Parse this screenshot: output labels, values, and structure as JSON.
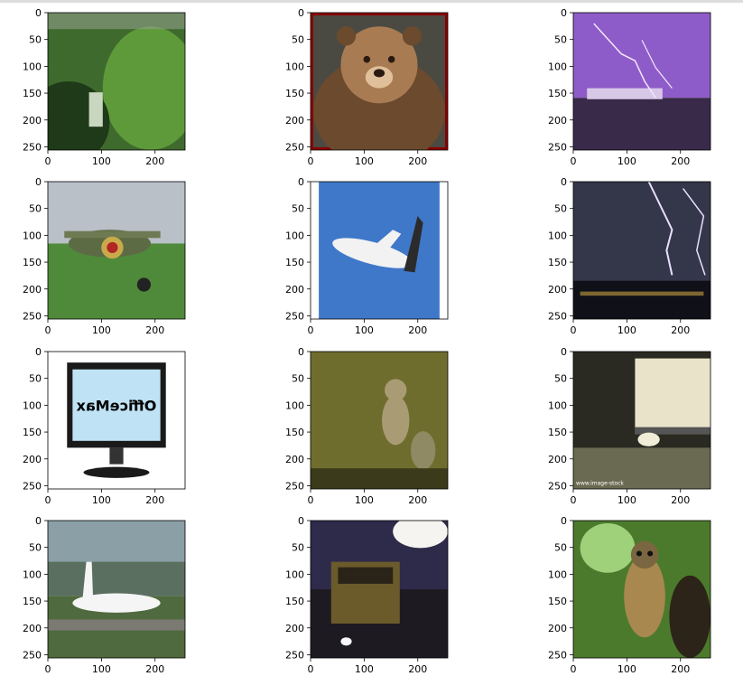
{
  "figure": {
    "rows": 4,
    "cols": 3,
    "panels": [
      {
        "subject": "waterfall-in-forest",
        "colors": {
          "bg": "#3f6a2e",
          "accent": "#c9d7c0",
          "dark": "#1f3a18"
        }
      },
      {
        "subject": "brown-bear-portrait",
        "colors": {
          "bg": "#6b4a2e",
          "accent": "#a87b52",
          "dark": "#2a1a10",
          "border": "#8b0000"
        }
      },
      {
        "subject": "purple-lightning-over-city",
        "colors": {
          "bg": "#8e5cc8",
          "accent": "#f4e6ff",
          "dark": "#3a2a4a"
        }
      },
      {
        "subject": "vintage-propeller-airplane",
        "colors": {
          "bg": "#b9c0c8",
          "accent": "#5d6b45",
          "dark": "#4f8a3a"
        }
      },
      {
        "subject": "passenger-jet-in-sky",
        "colors": {
          "bg": "#3f78c8",
          "accent": "#f2f2f2",
          "dark": "#2b2b2b"
        }
      },
      {
        "subject": "lightning-over-night-city",
        "colors": {
          "bg": "#34364a",
          "accent": "#e8e0ff",
          "dark": "#101018"
        }
      },
      {
        "subject": "computer-monitor",
        "colors": {
          "bg": "#ffffff",
          "accent": "#bfe3f5",
          "dark": "#1a1a1a"
        }
      },
      {
        "subject": "owl-in-grass",
        "colors": {
          "bg": "#6f6d2e",
          "accent": "#a99b73",
          "dark": "#3b3a1a"
        }
      },
      {
        "subject": "light-bulb-on-windowsill",
        "colors": {
          "bg": "#6a6a52",
          "accent": "#e9e3c9",
          "dark": "#2a2a22"
        }
      },
      {
        "subject": "cargo-jet-on-runway",
        "colors": {
          "bg": "#8aa0a6",
          "accent": "#f5f5f5",
          "dark": "#4f6a3e"
        }
      },
      {
        "subject": "school-bus-at-night",
        "colors": {
          "bg": "#3c3558",
          "accent": "#f6f4f0",
          "dark": "#1e1a22"
        }
      },
      {
        "subject": "barred-owl-in-tree",
        "colors": {
          "bg": "#4c7a2c",
          "accent": "#a8884f",
          "dark": "#2c2418"
        }
      }
    ],
    "x_ticks": [
      "0",
      "100",
      "200"
    ],
    "y_ticks": [
      "0",
      "50",
      "100",
      "150",
      "200",
      "250"
    ],
    "axis_range": [
      0,
      256
    ],
    "overlay_text": {
      "monitor_brand": "OfficeMax",
      "bulb_watermark": "www.image-stock"
    }
  },
  "chart_data": {
    "type": "image_grid",
    "rows": 4,
    "cols": 3,
    "image_size": [
      256,
      256
    ],
    "x_ticks": [
      0,
      100,
      200
    ],
    "y_ticks": [
      0,
      50,
      100,
      150,
      200,
      250
    ],
    "xlim": [
      0,
      256
    ],
    "ylim": [
      256,
      0
    ],
    "grid": false
  }
}
